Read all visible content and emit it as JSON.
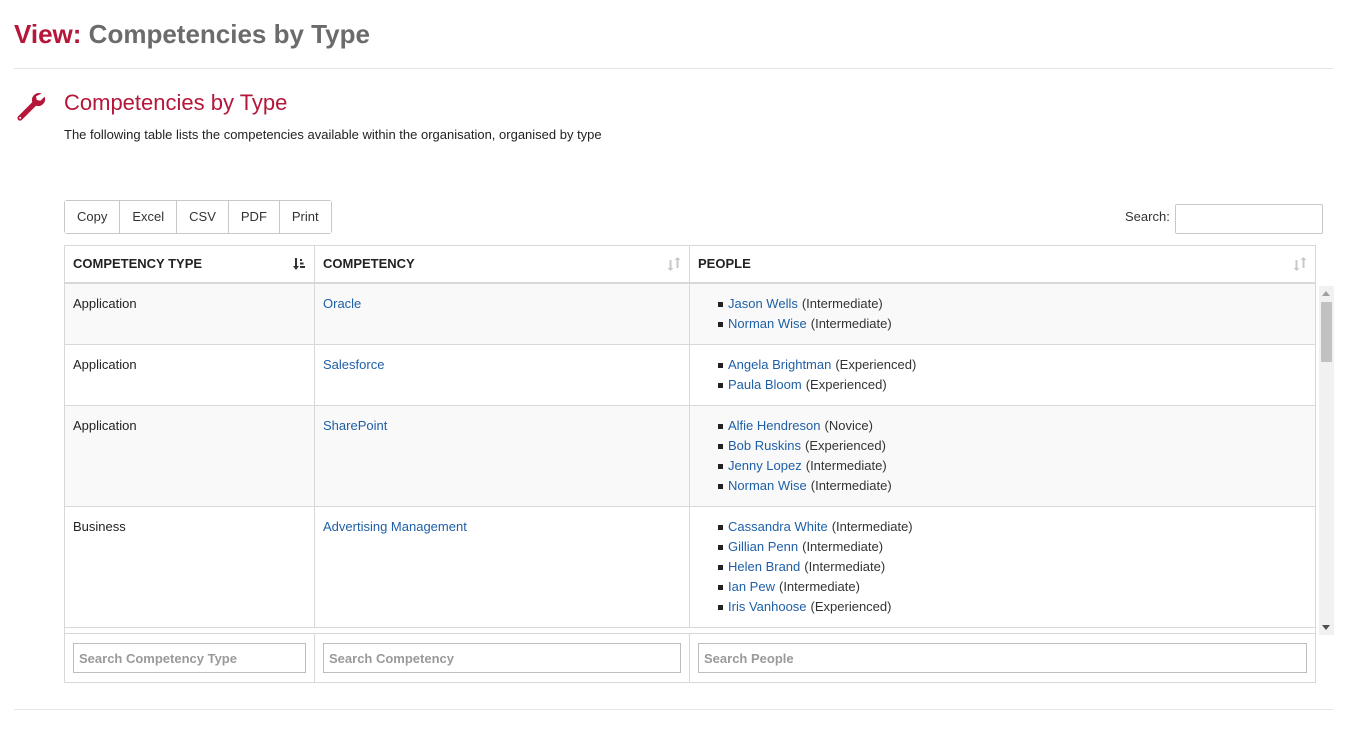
{
  "header": {
    "prefix": "View:",
    "title": "Competencies by Type"
  },
  "section": {
    "icon": "wrench-icon",
    "title": "Competencies by Type",
    "description": "The following table lists the competencies available within the organisation, organised by type"
  },
  "toolbar": {
    "buttons": [
      "Copy",
      "Excel",
      "CSV",
      "PDF",
      "Print"
    ],
    "search_label": "Search:",
    "search_value": ""
  },
  "table": {
    "columns": [
      "COMPETENCY TYPE",
      "COMPETENCY",
      "PEOPLE"
    ],
    "rows": [
      {
        "type": "Application",
        "competency": "Oracle",
        "people": [
          {
            "name": "Jason Wells",
            "level": "(Intermediate)"
          },
          {
            "name": "Norman Wise",
            "level": "(Intermediate)"
          }
        ]
      },
      {
        "type": "Application",
        "competency": "Salesforce",
        "people": [
          {
            "name": "Angela Brightman",
            "level": "(Experienced)"
          },
          {
            "name": "Paula Bloom",
            "level": "(Experienced)"
          }
        ]
      },
      {
        "type": "Application",
        "competency": "SharePoint",
        "people": [
          {
            "name": "Alfie Hendreson",
            "level": "(Novice)"
          },
          {
            "name": "Bob Ruskins",
            "level": "(Experienced)"
          },
          {
            "name": "Jenny Lopez",
            "level": "(Intermediate)"
          },
          {
            "name": "Norman Wise",
            "level": "(Intermediate)"
          }
        ]
      },
      {
        "type": "Business",
        "competency": "Advertising Management",
        "people": [
          {
            "name": "Cassandra White",
            "level": "(Intermediate)"
          },
          {
            "name": "Gillian Penn",
            "level": "(Intermediate)"
          },
          {
            "name": "Helen Brand",
            "level": "(Intermediate)"
          },
          {
            "name": "Ian Pew",
            "level": "(Intermediate)"
          },
          {
            "name": "Iris Vanhoose",
            "level": "(Experienced)"
          }
        ]
      }
    ],
    "footer_placeholders": [
      "Search Competency Type",
      "Search Competency",
      "Search People"
    ]
  },
  "colors": {
    "accent": "#b5173a",
    "link": "#1f5fa6",
    "title_gray": "#6b6b6b"
  }
}
